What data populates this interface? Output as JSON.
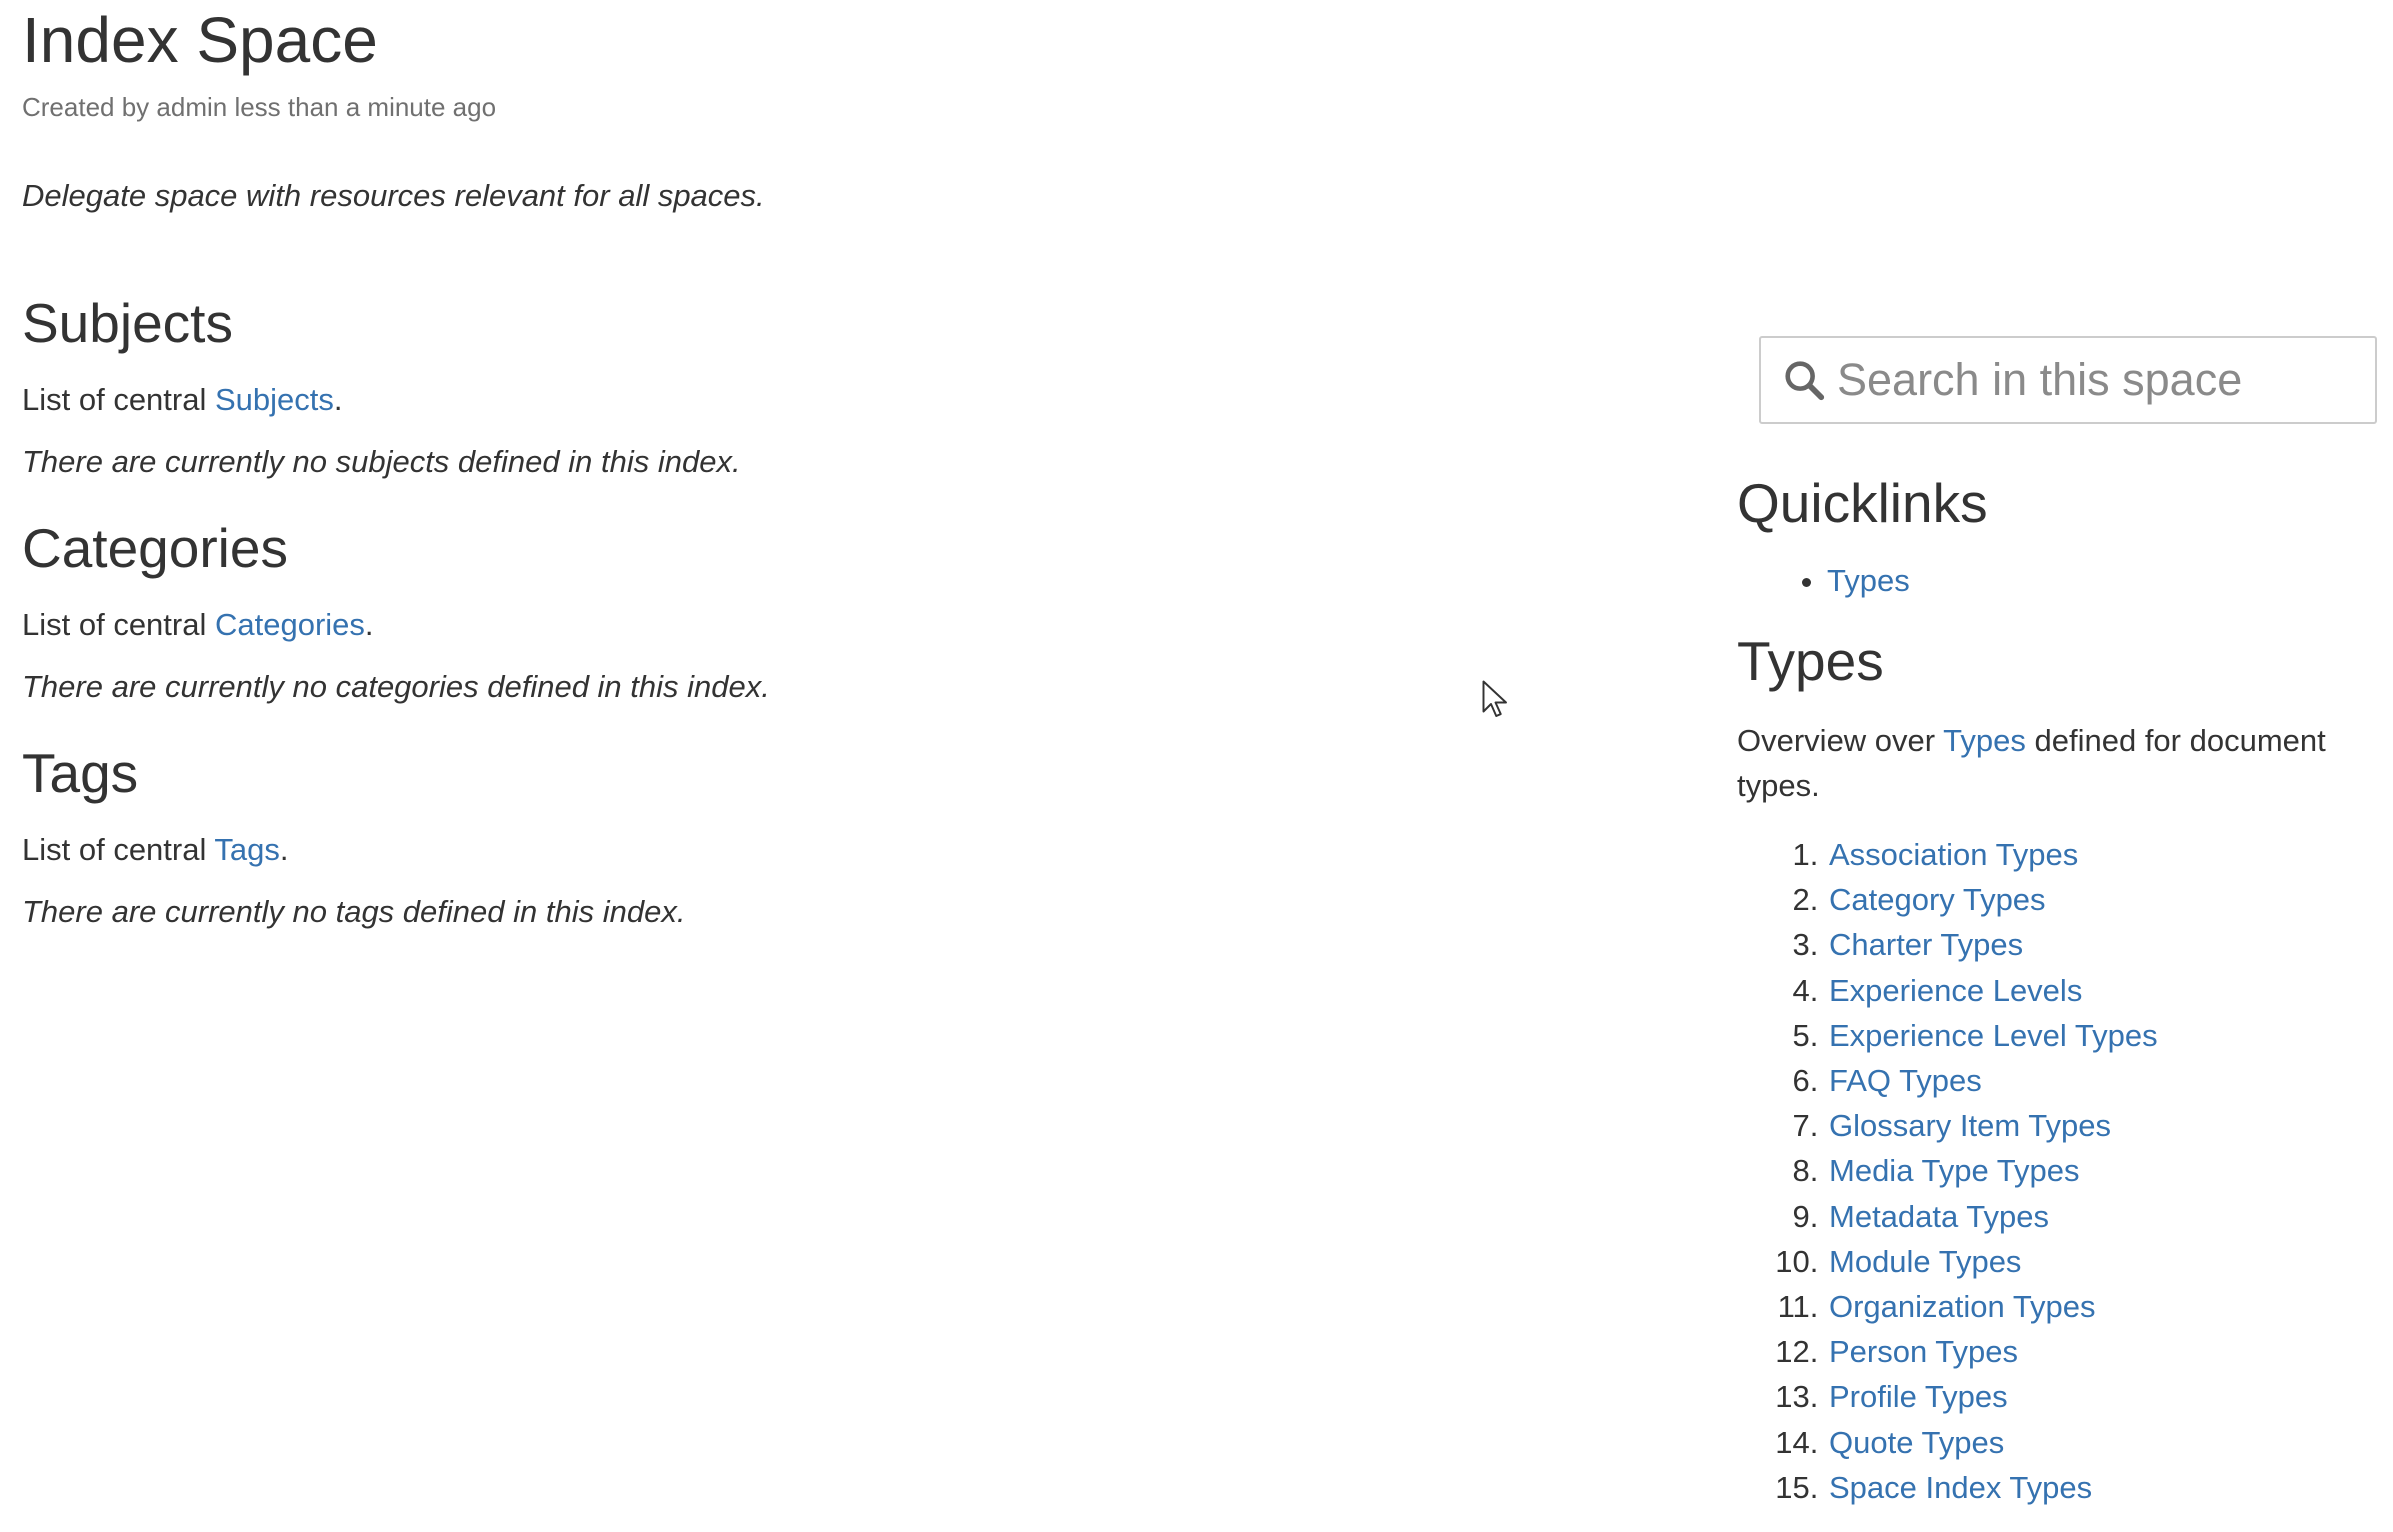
{
  "page": {
    "title": "Index Space",
    "byline": "Created by admin less than a minute ago",
    "lead": "Delegate space with resources relevant for all spaces."
  },
  "sections": {
    "subjects": {
      "heading": "Subjects",
      "desc_prefix": "List of central ",
      "link": "Subjects",
      "desc_suffix": ".",
      "empty": "There are currently no subjects defined in this index."
    },
    "categories": {
      "heading": "Categories",
      "desc_prefix": "List of central ",
      "link": "Categories",
      "desc_suffix": ".",
      "empty": "There are currently no categories defined in this index."
    },
    "tags": {
      "heading": "Tags",
      "desc_prefix": "List of central ",
      "link": "Tags",
      "desc_suffix": ".",
      "empty": "There are currently no tags defined in this index."
    }
  },
  "sidebar": {
    "search": {
      "placeholder": "Search in this space"
    },
    "quicklinks": {
      "heading": "Quicklinks",
      "items": [
        "Types"
      ]
    },
    "types": {
      "heading": "Types",
      "desc_prefix": "Overview over ",
      "desc_link": "Types",
      "desc_suffix": " defined for document types.",
      "items": [
        "Association Types",
        "Category Types",
        "Charter Types",
        "Experience Levels",
        "Experience Level Types",
        "FAQ Types",
        "Glossary Item Types",
        "Media Type Types",
        "Metadata Types",
        "Module Types",
        "Organization Types",
        "Person Types",
        "Profile Types",
        "Quote Types",
        "Space Index Types"
      ]
    }
  },
  "colors": {
    "link": "#3572b0",
    "text": "#333333",
    "muted": "#707070"
  }
}
